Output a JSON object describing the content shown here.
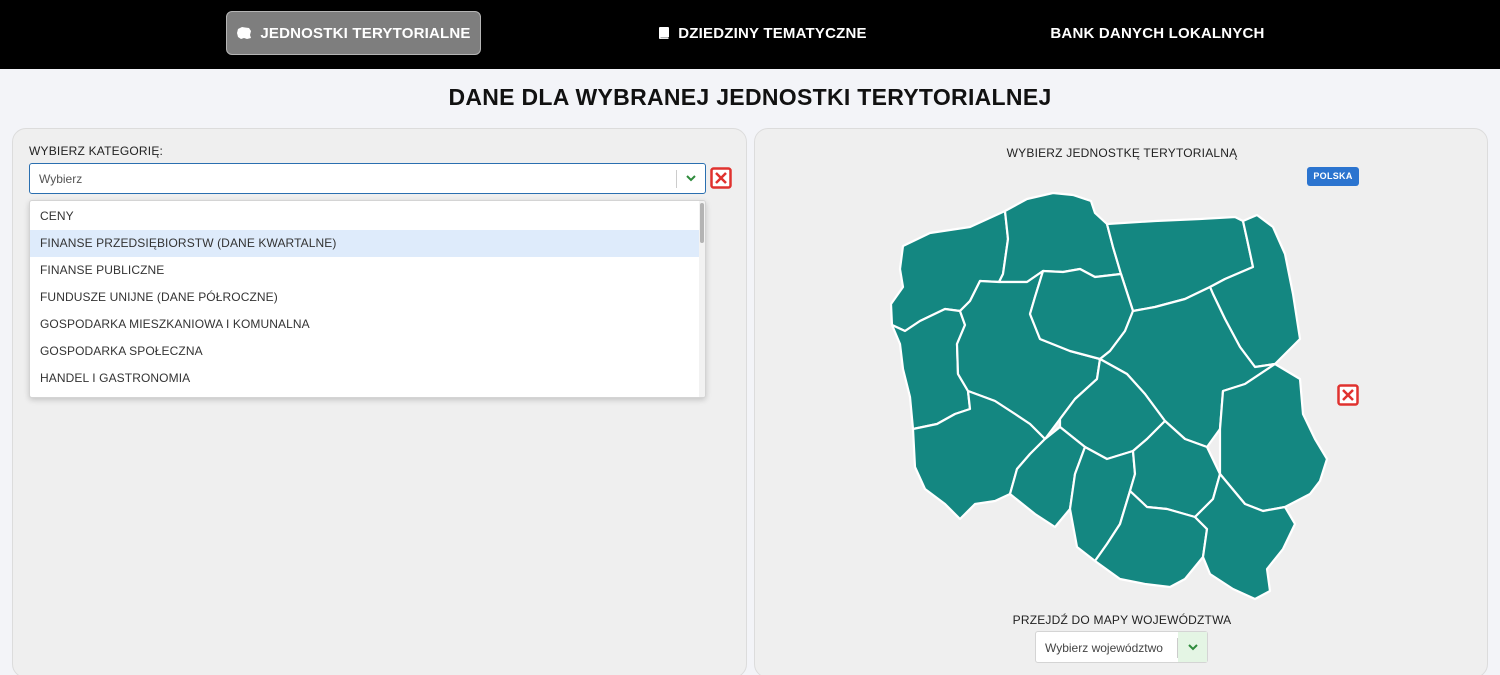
{
  "nav": {
    "tabs": [
      {
        "label": "JEDNOSTKI TERYTORIALNE",
        "icon": "poland-map-icon",
        "active": true
      },
      {
        "label": "DZIEDZINY TEMATYCZNE",
        "icon": "book-icon",
        "active": false
      },
      {
        "label": "BANK DANYCH LOKALNYCH",
        "icon": "",
        "active": false
      }
    ]
  },
  "page": {
    "title": "DANE DLA WYBRANEJ JEDNOSTKI TERYTORIALNEJ"
  },
  "category": {
    "label": "WYBIERZ KATEGORIĘ:",
    "value": "Wybierz",
    "options": [
      "CENY",
      "FINANSE PRZEDSIĘBIORSTW (DANE KWARTALNE)",
      "FINANSE PUBLICZNE",
      "FUNDUSZE UNIJNE (DANE PÓŁROCZNE)",
      "GOSPODARKA MIESZKANIOWA I KOMUNALNA",
      "GOSPODARKA SPOŁECZNA",
      "HANDEL I GASTRONOMIA"
    ],
    "highlighted_option": "FINANSE PRZEDSIĘBIORSTW (DANE KWARTALNE)"
  },
  "map": {
    "label": "WYBIERZ JEDNOSTKĘ TERYTORIALNĄ",
    "badge": "POLSKA",
    "region_color": "#148781",
    "goto_label": "PRZEJDŹ DO MAPY WOJEWÓDZTWA",
    "voivodeship_select": "Wybierz województwo"
  },
  "colors": {
    "topbar": "#000000",
    "active_tab": "#7e7e7e",
    "accent_blue": "#2b74cf",
    "clear_red": "#e0322f",
    "chevron_green": "#2e8b3c"
  }
}
